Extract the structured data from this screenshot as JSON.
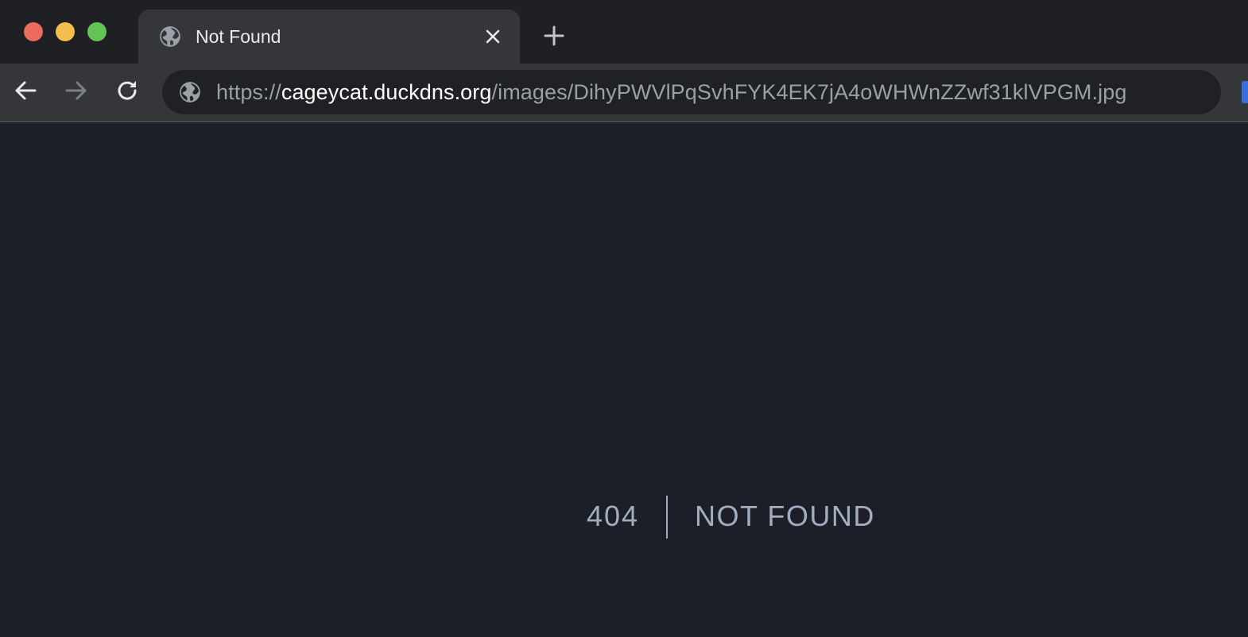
{
  "window": {
    "controls": {
      "close_color": "#ed6a5e",
      "minimize_color": "#f5bf4f",
      "maximize_color": "#61c454"
    }
  },
  "tabs": [
    {
      "title": "Not Found",
      "favicon": "globe-icon",
      "close_icon": "close-icon",
      "active": true
    }
  ],
  "new_tab_icon": "plus-icon",
  "toolbar": {
    "back_icon": "arrow-left-icon",
    "forward_icon": "arrow-right-icon",
    "reload_icon": "reload-icon",
    "omnibox": {
      "site_icon": "globe-icon",
      "url_scheme": "https://",
      "url_host": "cageycat.duckdns.org",
      "url_path": "/images/DihyPWVlPqSvhFYK4EK7jA4oWHWnZZwf31klVPGM.jpg"
    }
  },
  "page": {
    "error_code": "404",
    "error_message": "NOT FOUND",
    "background_color": "#1c1f28",
    "text_color": "#a0aec0"
  }
}
